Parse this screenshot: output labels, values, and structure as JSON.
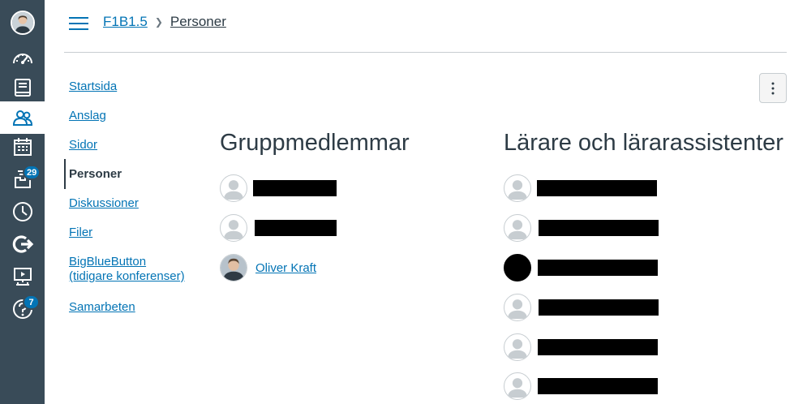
{
  "global_nav": {
    "items": [
      {
        "icon": "account-avatar-icon"
      },
      {
        "icon": "dashboard-icon"
      },
      {
        "icon": "courses-icon"
      },
      {
        "icon": "groups-icon",
        "active": true
      },
      {
        "icon": "calendar-icon"
      },
      {
        "icon": "inbox-icon",
        "badge": "29"
      },
      {
        "icon": "history-icon"
      },
      {
        "icon": "commons-icon"
      },
      {
        "icon": "studio-icon"
      },
      {
        "icon": "help-icon",
        "badge": "7"
      }
    ],
    "colors": {
      "background": "#394b58",
      "badge": "#0374b5",
      "active": "#ffffff"
    }
  },
  "header": {
    "breadcrumb": {
      "course": "F1B1.5",
      "current": "Personer"
    }
  },
  "course_nav": {
    "items": [
      {
        "label": "Startsida"
      },
      {
        "label": "Anslag"
      },
      {
        "label": "Sidor"
      },
      {
        "label": "Personer",
        "active": true
      },
      {
        "label": "Diskussioner"
      },
      {
        "label": "Filer"
      },
      {
        "label": "BigBlueButton\n(tidigare konferenser)"
      },
      {
        "label": "Samarbeten"
      }
    ]
  },
  "group_members": {
    "title": "Gruppmedlemmar",
    "members": [
      {
        "name": "",
        "redacted": true
      },
      {
        "name": "",
        "redacted": true
      },
      {
        "name": "Oliver Kraft",
        "redacted": false
      }
    ]
  },
  "teachers": {
    "title": "Lärare och lärarassistenter",
    "members": [
      {
        "redacted": true
      },
      {
        "redacted": true
      },
      {
        "redacted": true,
        "avatar": "black"
      },
      {
        "redacted": true
      },
      {
        "redacted": true
      },
      {
        "redacted": true
      }
    ]
  },
  "options_button": {
    "icon": "more-vertical-icon"
  },
  "accent_color": "#0374b5"
}
